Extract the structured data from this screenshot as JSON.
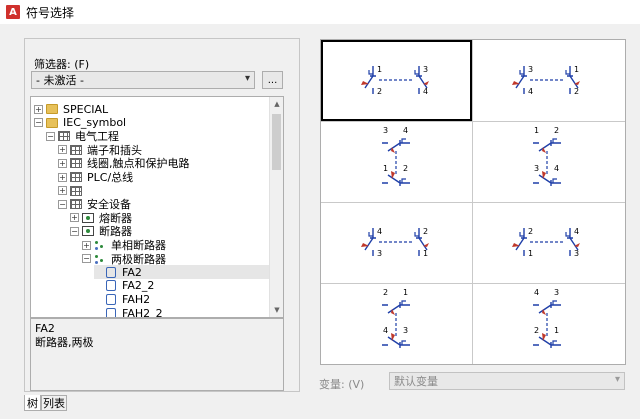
{
  "window": {
    "title": "符号选择",
    "app_icon_letter": "A"
  },
  "filter": {
    "label": "筛选器: (F)",
    "selected": "- 未激活 -",
    "more_label": "..."
  },
  "tree": {
    "items": [
      {
        "label": "SPECIAL",
        "icon": "folder-icon",
        "expander": "+"
      },
      {
        "label": "IEC_symbol",
        "icon": "folder-icon",
        "expander": "−"
      },
      {
        "label": "电气工程",
        "icon": "grid-icon",
        "expander": "−"
      },
      {
        "label": "端子和插头",
        "icon": "grid-icon",
        "expander": "+"
      },
      {
        "label": "线圈,触点和保护电路",
        "icon": "grid-icon",
        "expander": "+"
      },
      {
        "label": "PLC/总线",
        "icon": "grid-icon",
        "expander": "+"
      },
      {
        "label": "",
        "icon": "grid-icon",
        "expander": "+"
      },
      {
        "label": "安全设备",
        "icon": "grid-icon",
        "expander": "−"
      },
      {
        "label": "熔断器",
        "icon": "green-icon",
        "expander": "+"
      },
      {
        "label": "断路器",
        "icon": "green-icon",
        "expander": "−"
      },
      {
        "label": "单相断路器",
        "icon": "dots-icon",
        "expander": "+"
      },
      {
        "label": "两极断路器",
        "icon": "dots-icon",
        "expander": "−"
      },
      {
        "label": "FA2",
        "icon": "symbol-icon"
      },
      {
        "label": "FA2_2",
        "icon": "symbol-icon"
      },
      {
        "label": "FAH2",
        "icon": "symbol-icon"
      },
      {
        "label": "FAH2_2",
        "icon": "symbol-icon"
      }
    ]
  },
  "description": {
    "name": "FA2",
    "text": "断路器,两极"
  },
  "tabs": {
    "tree": "树",
    "list": "列表"
  },
  "symbols": [
    {
      "p": [
        "1",
        "2",
        "3",
        "4"
      ]
    },
    {
      "p": [
        "3",
        "4",
        "1",
        "2"
      ]
    },
    {
      "p": [
        "3",
        "4",
        "1",
        "2"
      ]
    },
    {
      "p": [
        "1",
        "2",
        "3",
        "4"
      ]
    },
    {
      "p": [
        "4",
        "3",
        "2",
        "1"
      ]
    },
    {
      "p": [
        "2",
        "1",
        "4",
        "3"
      ]
    },
    {
      "p": [
        "2",
        "1",
        "4",
        "3"
      ]
    },
    {
      "p": [
        "4",
        "3",
        "2",
        "1"
      ]
    }
  ],
  "variant": {
    "label": "变量: (V)",
    "selected": "默认变量"
  },
  "colors": {
    "symbol_blue": "#1f3fa8",
    "symbol_red": "#c0392b"
  }
}
